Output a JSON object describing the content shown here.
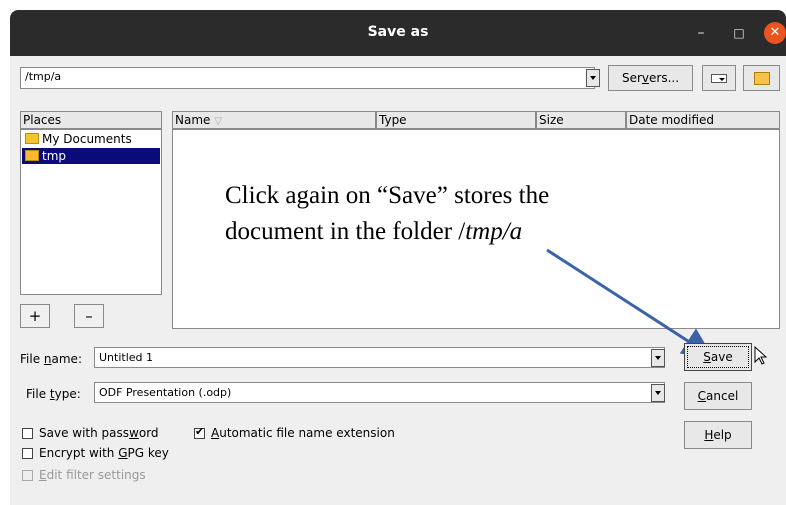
{
  "window": {
    "title": "Save as"
  },
  "titlebar": {
    "minimize": "–",
    "maximize": "□",
    "close": "✕"
  },
  "location": {
    "path": "/tmp/a",
    "servers_label": "Servers...",
    "servers_pre": "Ser",
    "servers_u": "v",
    "servers_post": "ers..."
  },
  "places": {
    "header": "Places",
    "items": [
      {
        "label": "My Documents"
      },
      {
        "label": "tmp"
      }
    ],
    "add_label": "+",
    "remove_label": "–"
  },
  "columns": {
    "name": "Name",
    "sort_indicator": "▽",
    "type": "Type",
    "size": "Size",
    "date": "Date modified"
  },
  "annotation": {
    "line1": "Click again on “Save” stores the",
    "line2_prefix": "document in the folder /",
    "line2_italic": "tmp/a"
  },
  "file_name": {
    "label_pre": "File ",
    "label_u": "n",
    "label_post": "ame:",
    "value": "Untitled 1"
  },
  "file_type": {
    "label_pre": "File ",
    "label_u": "t",
    "label_post": "ype:",
    "value": "ODF Presentation (.odp)"
  },
  "buttons": {
    "save_u": "S",
    "save_rest": "ave",
    "cancel_u": "C",
    "cancel_rest": "ancel",
    "help_u": "H",
    "help_rest": "elp"
  },
  "options": {
    "save_password_pre": "Save with pass",
    "save_password_u": "w",
    "save_password_post": "ord",
    "auto_ext_u": "A",
    "auto_ext_rest": "utomatic file name extension",
    "gpg_pre": "Encrypt with ",
    "gpg_u": "G",
    "gpg_post": "PG key",
    "filter_u": "E",
    "filter_rest": "dit filter settings",
    "auto_ext_checked": true
  },
  "colors": {
    "titlebar": "#2b2b2b",
    "selection": "#0a0a7a",
    "close": "#e95420"
  }
}
